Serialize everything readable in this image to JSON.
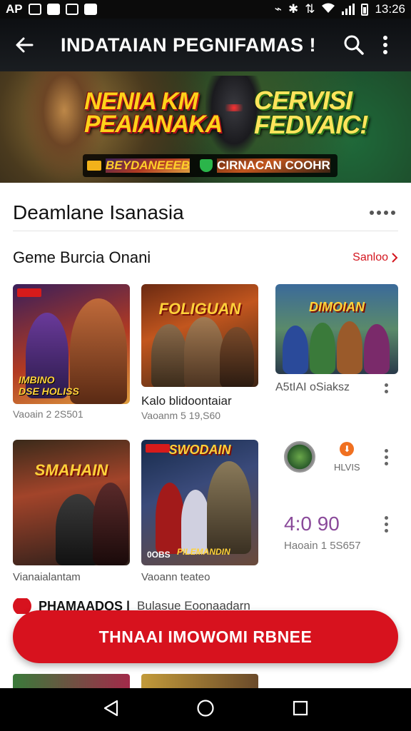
{
  "status_bar": {
    "carrier": "AP",
    "time": "13:26"
  },
  "app_bar": {
    "title": "INDATAIAN PEGNIFAMAS !"
  },
  "banner": {
    "title_left": "NENIA KM\nPEAIANAKA",
    "title_right": "CERVISI\nFEDVAIC!",
    "strip_left": "BEYDANEEEB",
    "strip_right": "CIRNACAN COOHR"
  },
  "section": {
    "title": "Deamlane Isanasia",
    "subtitle": "Geme Burcia Onani",
    "see_all": "Sanloo"
  },
  "games_row1": [
    {
      "thumb_caption": "IMBINO\nDSE HOLISS",
      "name": "",
      "meta": "Vaoain 2 2S501"
    },
    {
      "thumb_caption": "FOLIGUAN",
      "name": "Kalo blidoontaiar",
      "meta": "Vaoanm 5 19,S60"
    },
    {
      "thumb_caption": "DIMOIAN",
      "name": "A5tIAI oSiaksz",
      "meta": ""
    }
  ],
  "games_row2": [
    {
      "thumb_caption": "SMAHAIN",
      "name": "",
      "meta": "Vianaialantam"
    },
    {
      "thumb_caption": "SWODAIN",
      "name": "",
      "meta": "Vaoann teateo",
      "badge_text": "0OBS",
      "caption2": "PILEMANDIN"
    }
  ],
  "side_item": {
    "label": "HLVIS",
    "number": "4:0 90",
    "meta": "Haoain 1 5S657"
  },
  "peek": {
    "title": "PHAMAADOS |",
    "subtitle": "Bulasue Eoonaadarn"
  },
  "cta": {
    "label": "THNAAI IMOWOMI RBNEE"
  }
}
